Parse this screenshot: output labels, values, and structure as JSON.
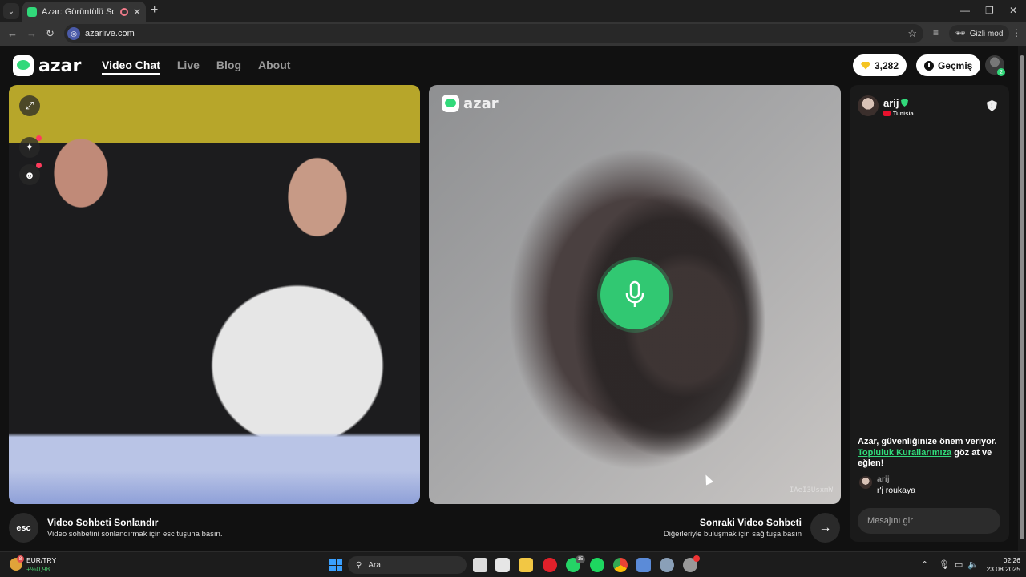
{
  "browser": {
    "tab_title": "Azar: Görüntülü Sohbet, Ar",
    "url": "azarlive.com",
    "incognito_label": "Gizli mod"
  },
  "site": {
    "logo_text": "azar",
    "nav": [
      {
        "label": "Video Chat",
        "active": true
      },
      {
        "label": "Live",
        "active": false
      },
      {
        "label": "Blog",
        "active": false
      },
      {
        "label": "About",
        "active": false
      }
    ],
    "gems": "3,282",
    "history_label": "Geçmiş",
    "profile_badge": "2"
  },
  "video": {
    "watermark": "azar",
    "remote_id": "IAeI3UsxmW",
    "mic_icon": "mic-icon"
  },
  "controls": {
    "esc_key": "esc",
    "end_title": "Video Sohbeti Sonlandır",
    "end_desc": "Video sohbetini sonlandırmak için esc tuşuna basın.",
    "next_title": "Sonraki Video Sohbeti",
    "next_desc": "Diğerleriyle buluşmak için sağ tuşa basın"
  },
  "chat": {
    "partner_name": "arij",
    "country": "Tunisia",
    "safety_prefix": "Azar, güvenliğinize önem veriyor.",
    "safety_link": "Topluluk Kurallarımıza",
    "safety_suffix": "göz at ve eğlen!",
    "messages": [
      {
        "sender": "arij",
        "text": "r'j roukaya"
      }
    ],
    "input_placeholder": "Mesajını gir"
  },
  "taskbar": {
    "stock_badge": "8",
    "stock_name": "EUR/TRY",
    "stock_change": "+%0,98",
    "search_placeholder": "Ara",
    "whatsapp_badge": "15",
    "time": "02:26",
    "date": "23.08.2025"
  },
  "colors": {
    "accent": "#31d97a",
    "background": "#111111",
    "panel": "#1a1a1a"
  }
}
